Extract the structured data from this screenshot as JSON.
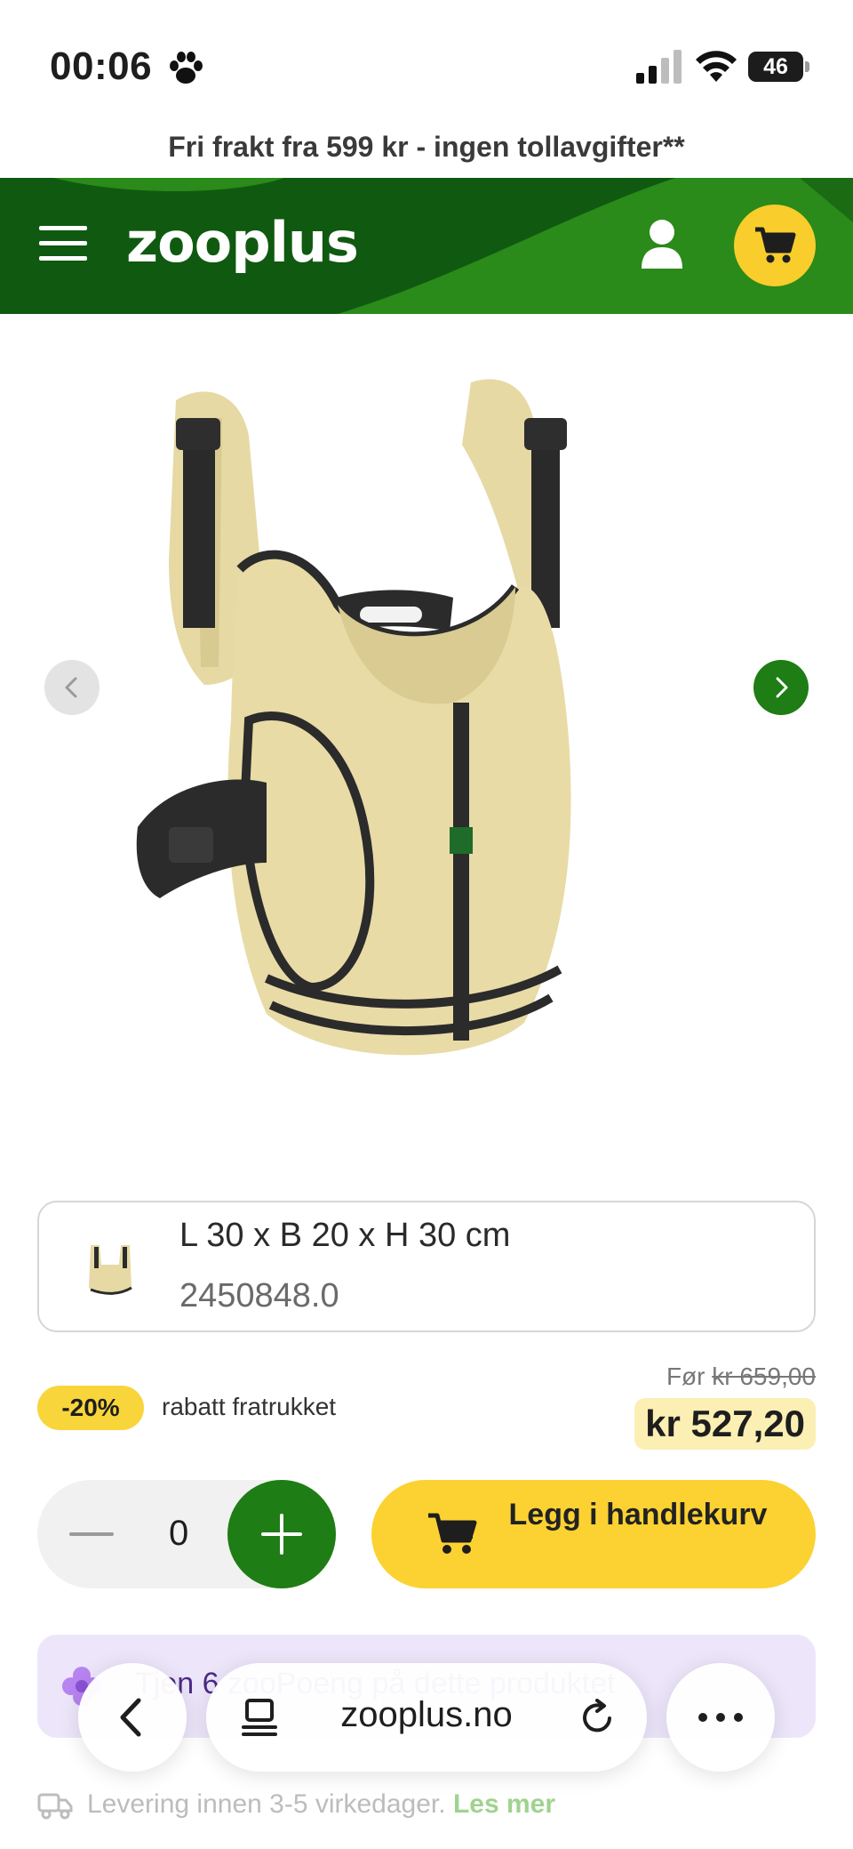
{
  "status_bar": {
    "time": "00:06",
    "battery": "46"
  },
  "banner": {
    "text": "Fri frakt fra 599 kr - ingen tollavgifter**"
  },
  "header": {
    "logo": "zooplus"
  },
  "variant": {
    "size": "L 30 x B 20 x H 30 cm",
    "sku": "2450848.0"
  },
  "price": {
    "discount_badge": "-20%",
    "discount_text": "rabatt fratrukket",
    "before_label": "Før",
    "before_value": "kr 659,00",
    "current": "kr 527,20"
  },
  "quantity": {
    "value": "0"
  },
  "add_to_cart": {
    "label": "Legg i handlekurv"
  },
  "promo": {
    "text": "Tjen 6 zooPoeng på dette produktet"
  },
  "browser": {
    "url": "zooplus.no"
  },
  "delivery": {
    "text": "Levering innen 3-5 virkedager.",
    "link": "Les mer"
  },
  "colors": {
    "brand_green": "#1e7d14",
    "accent_yellow": "#fcd232",
    "header_dark": "#0f5a10"
  }
}
